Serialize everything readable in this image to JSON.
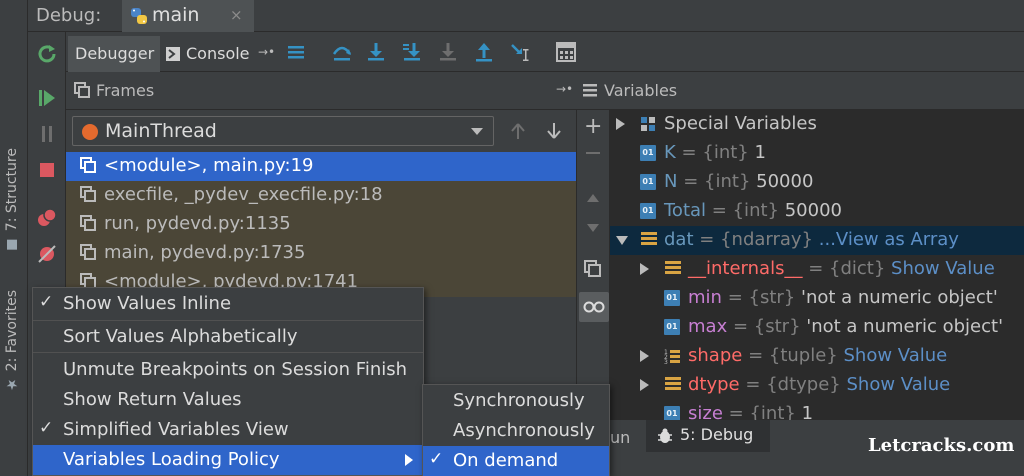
{
  "title_bar": {
    "label": "Debug:",
    "tab_label": "main",
    "tab_close": "×"
  },
  "left_stripe": {
    "structure": "7: Structure",
    "favorites": "2: Favorites"
  },
  "toolbar": {
    "debugger_tab": "Debugger",
    "console_tab": "Console",
    "console_pin": "→•"
  },
  "frames": {
    "header": "Frames",
    "thread": "MainThread",
    "rows": [
      {
        "label": "<module>, main.py:19",
        "selected": true
      },
      {
        "label": "execfile, _pydev_execfile.py:18",
        "selected": false
      },
      {
        "label": "run, pydevd.py:1135",
        "selected": false
      },
      {
        "label": "main, pydevd.py:1735",
        "selected": false
      },
      {
        "label": "<module>, pydevd.py:1741",
        "selected": false
      }
    ]
  },
  "variables": {
    "header": "Variables",
    "pin": "→•",
    "rows": [
      {
        "name": "Special Variables",
        "kind": "special",
        "toggle": "closed"
      },
      {
        "name": "K",
        "type": "{int}",
        "value": "1",
        "kind": "01"
      },
      {
        "name": "N",
        "type": "{int}",
        "value": "50000",
        "kind": "01"
      },
      {
        "name": "Total",
        "type": "{int}",
        "value": "50000",
        "kind": "01"
      },
      {
        "name": "dat",
        "type": "{ndarray}",
        "link": "...View as Array",
        "kind": "array",
        "toggle": "open",
        "highlight": true
      },
      {
        "name": "__internals__",
        "type": "{dict}",
        "link": "Show Value",
        "kind": "array",
        "toggle": "closed"
      },
      {
        "name": "min",
        "type": "{str}",
        "value": "'not a numeric object'",
        "kind": "01"
      },
      {
        "name": "max",
        "type": "{str}",
        "value": "'not a numeric object'",
        "kind": "01"
      },
      {
        "name": "shape",
        "type": "{tuple}",
        "link": "Show Value",
        "kind": "tuple",
        "toggle": "closed"
      },
      {
        "name": "dtype",
        "type": "{dtype}",
        "link": "Show Value",
        "kind": "array",
        "toggle": "closed"
      },
      {
        "name": "size",
        "type": "{int}",
        "value": "1",
        "kind": "01"
      }
    ],
    "equals": "="
  },
  "context_menu": {
    "items": [
      {
        "label": "Show Values Inline",
        "checked": "✓"
      },
      {
        "label": "Sort Values Alphabetically",
        "checked": ""
      },
      {
        "label": "Unmute Breakpoints on Session Finish",
        "checked": ""
      },
      {
        "label": "Show Return Values",
        "checked": ""
      },
      {
        "label": "Simplified Variables View",
        "checked": "✓"
      },
      {
        "label": "Variables Loading Policy",
        "checked": ""
      }
    ]
  },
  "submenu": {
    "items": [
      {
        "label": "Synchronously",
        "checked": ""
      },
      {
        "label": "Asynchronously",
        "checked": ""
      },
      {
        "label": "On demand",
        "checked": "✓"
      }
    ]
  },
  "bottom": {
    "run_tab": "un",
    "debug_tab": "5: Debug",
    "watermark": "Letcracks.com"
  },
  "colors": {
    "selection": "#2f65ca",
    "frame_dim": "#4b4637",
    "highlight_row": "#0d293e",
    "accent_blue": "#3592c4",
    "resume_green": "#59a869",
    "stop_red": "#db5860"
  }
}
